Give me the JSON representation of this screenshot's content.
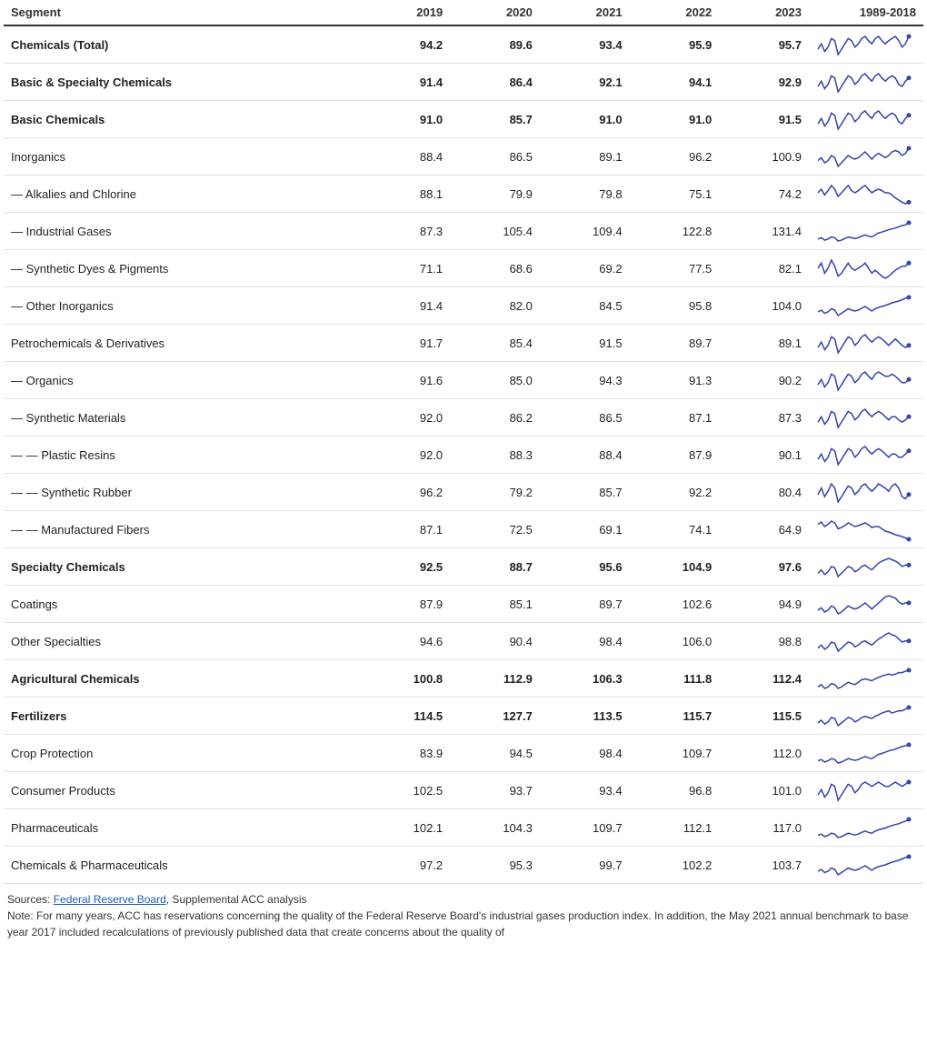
{
  "header": {
    "col_segment": "Segment",
    "col_2019": "2019",
    "col_2020": "2020",
    "col_2021": "2021",
    "col_2022": "2022",
    "col_2023": "2023",
    "col_historical": "1989-2018"
  },
  "rows": [
    {
      "label": "Chemicals (Total)",
      "bold": true,
      "y2019": "94.2",
      "y2020": "89.6",
      "y2021": "93.4",
      "y2022": "95.9",
      "y2023": "95.7",
      "spark": [
        60,
        65,
        58,
        62,
        70,
        68,
        55,
        60,
        65,
        70,
        68,
        62,
        65,
        70,
        72,
        68,
        65,
        70,
        72,
        68,
        65,
        68,
        70,
        72,
        68,
        62,
        65,
        72
      ]
    },
    {
      "label": "Basic & Specialty Chemicals",
      "bold": true,
      "y2019": "91.4",
      "y2020": "86.4",
      "y2021": "92.1",
      "y2022": "94.1",
      "y2023": "92.9",
      "spark": [
        60,
        65,
        58,
        62,
        70,
        68,
        55,
        60,
        65,
        70,
        68,
        62,
        65,
        70,
        72,
        68,
        65,
        70,
        72,
        68,
        65,
        68,
        70,
        68,
        62,
        60,
        65,
        68
      ]
    },
    {
      "label": "Basic Chemicals",
      "bold": true,
      "y2019": "91.0",
      "y2020": "85.7",
      "y2021": "91.0",
      "y2022": "91.0",
      "y2023": "91.5",
      "spark": [
        60,
        65,
        58,
        62,
        70,
        68,
        55,
        60,
        65,
        70,
        68,
        62,
        65,
        70,
        72,
        68,
        65,
        70,
        72,
        68,
        65,
        68,
        70,
        68,
        62,
        60,
        65,
        68
      ]
    },
    {
      "label": "Inorganics",
      "bold": false,
      "y2019": "88.4",
      "y2020": "86.5",
      "y2021": "89.1",
      "y2022": "96.2",
      "y2023": "100.9",
      "spark": [
        58,
        62,
        55,
        58,
        65,
        62,
        50,
        55,
        60,
        65,
        62,
        60,
        62,
        66,
        70,
        65,
        60,
        65,
        68,
        65,
        62,
        65,
        70,
        72,
        70,
        65,
        68,
        75
      ]
    },
    {
      "label": "— Alkalies and Chlorine",
      "bold": false,
      "y2019": "88.1",
      "y2020": "79.9",
      "y2021": "79.8",
      "y2022": "75.1",
      "y2023": "74.2",
      "spark": [
        65,
        70,
        62,
        68,
        75,
        70,
        60,
        65,
        70,
        75,
        68,
        65,
        68,
        72,
        75,
        70,
        65,
        68,
        70,
        68,
        65,
        65,
        62,
        58,
        55,
        52,
        50,
        52
      ]
    },
    {
      "label": "— Industrial Gases",
      "bold": false,
      "y2019": "87.3",
      "y2020": "105.4",
      "y2021": "109.4",
      "y2022": "122.8",
      "y2023": "131.4",
      "spark": [
        55,
        58,
        52,
        55,
        60,
        58,
        50,
        52,
        56,
        60,
        58,
        56,
        58,
        62,
        65,
        62,
        60,
        65,
        70,
        72,
        75,
        78,
        80,
        82,
        85,
        88,
        90,
        95
      ]
    },
    {
      "label": "— Synthetic Dyes & Pigments",
      "bold": false,
      "y2019": "71.1",
      "y2020": "68.6",
      "y2021": "69.2",
      "y2022": "77.5",
      "y2023": "82.1",
      "spark": [
        70,
        75,
        65,
        70,
        78,
        72,
        62,
        65,
        70,
        75,
        70,
        68,
        70,
        72,
        75,
        70,
        65,
        68,
        65,
        62,
        60,
        62,
        65,
        68,
        70,
        72,
        72,
        75
      ]
    },
    {
      "label": "— Other Inorganics",
      "bold": false,
      "y2019": "91.4",
      "y2020": "82.0",
      "y2021": "84.5",
      "y2022": "95.8",
      "y2023": "104.0",
      "spark": [
        58,
        62,
        55,
        58,
        65,
        62,
        50,
        55,
        60,
        65,
        62,
        60,
        62,
        66,
        70,
        65,
        60,
        65,
        68,
        70,
        72,
        75,
        78,
        80,
        82,
        85,
        88,
        90
      ]
    },
    {
      "label": "Petrochemicals & Derivatives",
      "bold": false,
      "y2019": "91.7",
      "y2020": "85.4",
      "y2021": "91.5",
      "y2022": "89.7",
      "y2023": "89.1",
      "spark": [
        60,
        65,
        58,
        62,
        70,
        68,
        55,
        60,
        65,
        70,
        68,
        62,
        65,
        70,
        72,
        68,
        65,
        68,
        70,
        68,
        65,
        62,
        65,
        68,
        65,
        62,
        60,
        62
      ]
    },
    {
      "label": "— Organics",
      "bold": false,
      "y2019": "91.6",
      "y2020": "85.0",
      "y2021": "94.3",
      "y2022": "91.3",
      "y2023": "90.2",
      "spark": [
        60,
        65,
        58,
        62,
        70,
        68,
        55,
        60,
        65,
        70,
        68,
        62,
        65,
        70,
        72,
        68,
        65,
        70,
        72,
        70,
        68,
        68,
        70,
        68,
        65,
        62,
        62,
        65
      ]
    },
    {
      "label": "— Synthetic Materials",
      "bold": false,
      "y2019": "92.0",
      "y2020": "86.2",
      "y2021": "86.5",
      "y2022": "87.1",
      "y2023": "87.3",
      "spark": [
        60,
        65,
        58,
        62,
        70,
        68,
        55,
        60,
        65,
        70,
        68,
        62,
        65,
        70,
        72,
        68,
        65,
        68,
        70,
        68,
        65,
        62,
        65,
        65,
        62,
        60,
        62,
        65
      ]
    },
    {
      "label": "— — Plastic Resins",
      "bold": false,
      "y2019": "92.0",
      "y2020": "88.3",
      "y2021": "88.4",
      "y2022": "87.9",
      "y2023": "90.1",
      "spark": [
        60,
        65,
        58,
        62,
        70,
        68,
        55,
        60,
        65,
        70,
        68,
        62,
        65,
        70,
        72,
        68,
        65,
        68,
        70,
        68,
        65,
        62,
        65,
        65,
        62,
        62,
        65,
        68
      ]
    },
    {
      "label": "— — Synthetic Rubber",
      "bold": false,
      "y2019": "96.2",
      "y2020": "79.2",
      "y2021": "85.7",
      "y2022": "92.2",
      "y2023": "80.4",
      "spark": [
        62,
        68,
        60,
        65,
        72,
        68,
        55,
        60,
        65,
        70,
        68,
        62,
        65,
        70,
        72,
        68,
        65,
        68,
        72,
        70,
        68,
        65,
        70,
        72,
        68,
        60,
        58,
        62
      ]
    },
    {
      "label": "— — Manufactured Fibers",
      "bold": false,
      "y2019": "87.1",
      "y2020": "72.5",
      "y2021": "69.1",
      "y2022": "74.1",
      "y2023": "64.9",
      "spark": [
        75,
        80,
        70,
        75,
        82,
        78,
        65,
        68,
        72,
        78,
        74,
        70,
        72,
        75,
        78,
        74,
        68,
        70,
        70,
        65,
        60,
        58,
        55,
        52,
        50,
        48,
        45,
        42
      ]
    },
    {
      "label": "Specialty Chemicals",
      "bold": true,
      "y2019": "92.5",
      "y2020": "88.7",
      "y2021": "95.6",
      "y2022": "104.9",
      "y2023": "97.6",
      "spark": [
        60,
        65,
        58,
        62,
        70,
        68,
        55,
        60,
        65,
        70,
        68,
        62,
        65,
        70,
        72,
        68,
        65,
        70,
        75,
        78,
        80,
        82,
        80,
        78,
        75,
        70,
        72,
        72
      ]
    },
    {
      "label": "Coatings",
      "bold": false,
      "y2019": "87.9",
      "y2020": "85.1",
      "y2021": "89.7",
      "y2022": "102.6",
      "y2023": "94.9",
      "spark": [
        58,
        62,
        55,
        58,
        65,
        62,
        52,
        55,
        60,
        65,
        62,
        60,
        62,
        66,
        70,
        65,
        60,
        65,
        70,
        75,
        80,
        82,
        80,
        78,
        72,
        68,
        70,
        70
      ]
    },
    {
      "label": "Other Specialties",
      "bold": false,
      "y2019": "94.6",
      "y2020": "90.4",
      "y2021": "98.4",
      "y2022": "106.0",
      "y2023": "98.8",
      "spark": [
        60,
        65,
        58,
        62,
        70,
        68,
        55,
        60,
        65,
        70,
        68,
        62,
        65,
        70,
        72,
        68,
        65,
        70,
        75,
        78,
        82,
        85,
        82,
        80,
        75,
        70,
        72,
        72
      ]
    },
    {
      "label": "Agricultural Chemicals",
      "bold": true,
      "y2019": "100.8",
      "y2020": "112.9",
      "y2021": "106.3",
      "y2022": "111.8",
      "y2023": "112.4",
      "spark": [
        55,
        60,
        52,
        55,
        62,
        60,
        52,
        55,
        60,
        65,
        62,
        60,
        65,
        70,
        72,
        70,
        68,
        72,
        75,
        78,
        80,
        82,
        80,
        82,
        85,
        85,
        88,
        90
      ]
    },
    {
      "label": "Fertilizers",
      "bold": true,
      "y2019": "114.5",
      "y2020": "127.7",
      "y2021": "113.5",
      "y2022": "115.7",
      "y2023": "115.5",
      "spark": [
        60,
        65,
        58,
        62,
        70,
        68,
        55,
        60,
        65,
        70,
        68,
        62,
        65,
        70,
        72,
        70,
        68,
        72,
        75,
        78,
        80,
        82,
        78,
        80,
        82,
        82,
        85,
        88
      ]
    },
    {
      "label": "Crop Protection",
      "bold": false,
      "y2019": "83.9",
      "y2020": "94.5",
      "y2021": "98.4",
      "y2022": "109.7",
      "y2023": "112.0",
      "spark": [
        55,
        58,
        52,
        55,
        60,
        58,
        50,
        52,
        56,
        60,
        58,
        56,
        58,
        62,
        65,
        62,
        60,
        65,
        70,
        72,
        75,
        78,
        80,
        82,
        85,
        88,
        90,
        92
      ]
    },
    {
      "label": "Consumer Products",
      "bold": false,
      "y2019": "102.5",
      "y2020": "93.7",
      "y2021": "93.4",
      "y2022": "96.8",
      "y2023": "101.0",
      "spark": [
        60,
        65,
        58,
        62,
        70,
        68,
        55,
        60,
        65,
        70,
        68,
        62,
        65,
        70,
        72,
        70,
        68,
        70,
        72,
        70,
        68,
        68,
        70,
        72,
        70,
        68,
        70,
        72
      ]
    },
    {
      "label": "Pharmaceuticals",
      "bold": false,
      "y2019": "102.1",
      "y2020": "104.3",
      "y2021": "109.7",
      "y2022": "112.1",
      "y2023": "117.0",
      "spark": [
        55,
        58,
        52,
        55,
        60,
        58,
        50,
        52,
        56,
        60,
        58,
        56,
        58,
        62,
        65,
        62,
        60,
        65,
        68,
        70,
        72,
        75,
        78,
        80,
        82,
        85,
        88,
        92
      ]
    },
    {
      "label": "Chemicals & Pharmaceuticals",
      "bold": false,
      "y2019": "97.2",
      "y2020": "95.3",
      "y2021": "99.7",
      "y2022": "102.2",
      "y2023": "103.7",
      "spark": [
        58,
        62,
        55,
        58,
        65,
        62,
        50,
        55,
        60,
        65,
        62,
        60,
        62,
        66,
        70,
        65,
        60,
        65,
        68,
        70,
        72,
        75,
        78,
        80,
        82,
        85,
        88,
        90
      ]
    }
  ],
  "footer": {
    "sources_label": "Sources:",
    "sources_link": "Federal Reserve Board",
    "sources_rest": ", Supplemental ACC analysis",
    "note": "Note: For many years, ACC has reservations concerning the quality of the Federal Reserve Board's industrial gases production index. In addition, the May 2021 annual benchmark to base year 2017 included recalculations of previously published data that create concerns about the quality of"
  }
}
